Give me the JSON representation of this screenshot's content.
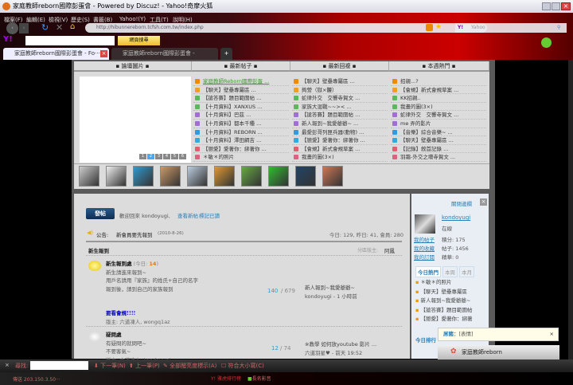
{
  "window": {
    "title": "家庭教師reborn國際彭蛋會 - Powered by Discuz! - Yahoo!奇摩火狐"
  },
  "menu": [
    "檔案(F)",
    "編輯(E)",
    "檢視(V)",
    "歷史(S)",
    "書籤(B)",
    "Yahoo!(Y)",
    "工具(T)",
    "說明(H)"
  ],
  "nav": {
    "url": "http://hibunnereborn.tcfsh.com.tw/index.php",
    "search_placeholder": "Yahoo",
    "yahoo_search_button": "網頁搜尋"
  },
  "tabs": [
    {
      "label": "家庭教師reborn國際彭蛋會 - Fo···",
      "active": true
    },
    {
      "label": "家庭教師reborn國際彭蛋會 - Powere···",
      "active": false
    }
  ],
  "top": {
    "headers": [
      "論壇圖片",
      "最新帖子",
      "最新回複",
      "本週熱門"
    ],
    "pager": [
      "1",
      "2",
      "3",
      "4",
      "5",
      "6"
    ],
    "new_posts": [
      "家庭教師Reborn國際彭蛋 ...",
      "【聊天】壁壘專屬區 ...",
      "【搶答賽】題目範圍帖 ...",
      "【十月資料】XANXUS ...",
      "【十月資料】巴茲 ...",
      "【十月資料】都本千種 ...",
      "【十月資料】REBORN ...",
      "【十月資料】澤田綱吉 ...",
      "【戀愛】愛著你：綁著你 ...",
      "＊敏＊的照片"
    ],
    "new_replies": [
      "【聊天】壁壘專屬區 ...",
      "夠營（獄×髏）",
      "蛇律外交　交響寺賀文 ...",
      "家族大混戰~~>< ...",
      "【搶答賽】題目範圍帖 ...",
      "新人報到~我愛爺爺~ ...",
      "最愛彭哥列匣兵器(動物) ...",
      "【戀愛】愛著你：綁著你 ...",
      "【會規】新式會規草案 ...",
      "我畫的圖(3×)"
    ],
    "hot": [
      "招親...?",
      "【會規】新式會規草案 ...",
      "KK招親..",
      "我畫的圖(3×)",
      "蛇律外交　交響寺賀文 ...",
      "me 弄的影片",
      "【音樂】綜合音樂~ ...",
      "【聊天】壁壘專屬區 ...",
      "【記錄】敘首記錄 ...",
      "羽霜-外交之壞寺賀文 ..."
    ],
    "icon_colors": [
      "#f08a00",
      "#f0a020",
      "#5cb85c",
      "#5cb85c",
      "#a070d0",
      "#a070d0",
      "#3399dd",
      "#33aadd",
      "#e06070",
      "#e06080"
    ]
  },
  "main": {
    "post_button": "發帖",
    "welcome": "歡迎回來 kondoyugi,",
    "view_new": "查看新帖",
    "mark_read": "標記已讀",
    "announce_label": "公告:",
    "announce_text": "新會員要先報到",
    "announce_date": "(2010-8-26)",
    "stats": "今日: 129, 昨日: 41, 會員: 280",
    "category": "新生報到",
    "moderator_label": "分區版主:",
    "moderator": "阿鳳",
    "forums": [
      {
        "name": "新生報到處",
        "today_label": "(今日:",
        "today": "14",
        "today_close": ")",
        "desc": [
          "新生請進來報到~",
          "用戶名請用『家族』的姓氏+自己的名字",
          "報到後，請到自己的家族報到"
        ],
        "topics": "140",
        "posts": "/ 679",
        "last_title": "新人報到~我愛爺爺~",
        "last_by": "kondoyugi - 1 小時前",
        "rules": "要看會規!!!!",
        "mods": "版主: 六道凍人, wongq1az"
      },
      {
        "name": "疑問處",
        "desc": [
          "有疑問的就問吧~",
          "不要客氣~"
        ],
        "topics": "12",
        "posts": "/ 74",
        "last_title": "※教學 如何放youtube 影片 ...",
        "last_by": "六道羽星♥ - 前天 19:52",
        "mods": "版主: 六道凍人, kondoyugi"
      }
    ]
  },
  "sidebar": {
    "close": "關閉邊欄",
    "username": "kondoyugi",
    "status": "在線",
    "links": [
      "我的帖子",
      "我的收藏",
      "我的訂閱"
    ],
    "points": "積分: 175",
    "post_count": "帖子: 1456",
    "essence": "精華: 0",
    "hot_tabs": [
      "今日熱門",
      "本周",
      "本月"
    ],
    "hot": [
      "＊敏＊的照片",
      "【聊天】壁壘專屬區",
      "新人報到~我愛爺爺~",
      "【搶答賽】題目範圍帖",
      "【戀愛】愛著你：綁著"
    ],
    "next_section": "今日排行"
  },
  "chat": {
    "sender": "屌豬：",
    "message": "[表情]",
    "title": "家庭教師reborn"
  },
  "findbar": {
    "label": "尋找:",
    "next": "下一筆(N)",
    "prev": "上一筆(P)",
    "highlight": "全部醒亮度標示(A)",
    "match_case": "符合大小寫(C)"
  },
  "status": {
    "left": "傳送 203.150.3.50···",
    "yahoo_ranking": "雅虎排行榜",
    "video": "長名影音"
  }
}
